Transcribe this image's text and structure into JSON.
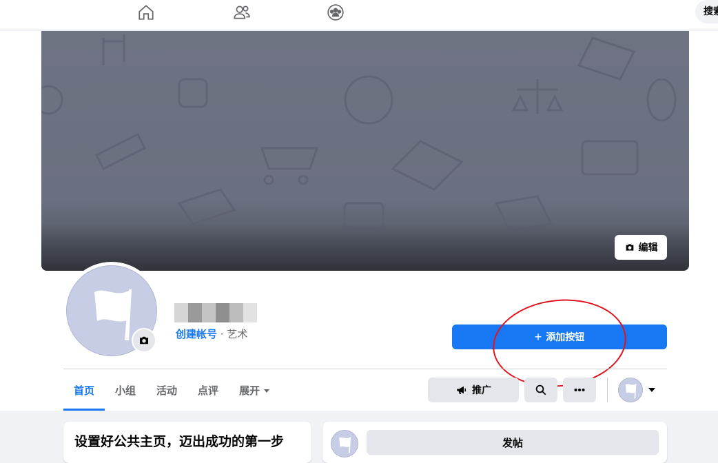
{
  "topbar": {
    "nav_icons": [
      "home-icon",
      "friends-icon",
      "groups-icon"
    ],
    "search_label": "搜索"
  },
  "cover": {
    "edit_label": "编辑"
  },
  "page": {
    "create_account_label": "创建帐号",
    "separator": " · ",
    "category": "艺术"
  },
  "actions": {
    "add_button_label": "添加按钮",
    "promote_label": "推广"
  },
  "tabs": [
    {
      "label": "首页",
      "active": true
    },
    {
      "label": "小组",
      "active": false
    },
    {
      "label": "活动",
      "active": false
    },
    {
      "label": "点评",
      "active": false
    },
    {
      "label": "展开",
      "active": false
    }
  ],
  "setup_card": {
    "title": "设置好公共主页，迈出成功的第一步"
  },
  "composer": {
    "post_label": "发帖"
  },
  "colors": {
    "accent": "#1877f2",
    "cover": "#6b7080",
    "annotation": "#e0141e"
  }
}
